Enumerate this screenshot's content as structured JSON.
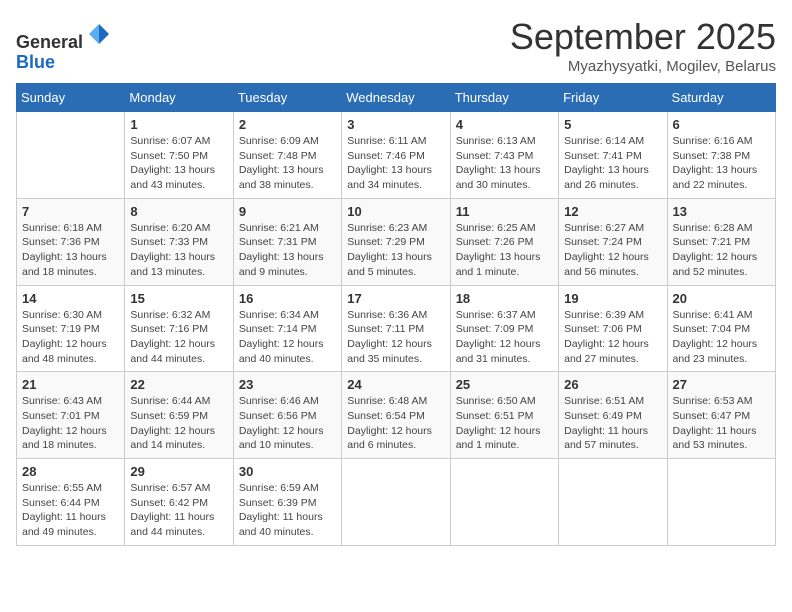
{
  "header": {
    "logo_line1": "General",
    "logo_line2": "Blue",
    "month_title": "September 2025",
    "location": "Myazhysyatki, Mogilev, Belarus"
  },
  "days_of_week": [
    "Sunday",
    "Monday",
    "Tuesday",
    "Wednesday",
    "Thursday",
    "Friday",
    "Saturday"
  ],
  "weeks": [
    [
      {
        "num": "",
        "info": ""
      },
      {
        "num": "1",
        "info": "Sunrise: 6:07 AM\nSunset: 7:50 PM\nDaylight: 13 hours\nand 43 minutes."
      },
      {
        "num": "2",
        "info": "Sunrise: 6:09 AM\nSunset: 7:48 PM\nDaylight: 13 hours\nand 38 minutes."
      },
      {
        "num": "3",
        "info": "Sunrise: 6:11 AM\nSunset: 7:46 PM\nDaylight: 13 hours\nand 34 minutes."
      },
      {
        "num": "4",
        "info": "Sunrise: 6:13 AM\nSunset: 7:43 PM\nDaylight: 13 hours\nand 30 minutes."
      },
      {
        "num": "5",
        "info": "Sunrise: 6:14 AM\nSunset: 7:41 PM\nDaylight: 13 hours\nand 26 minutes."
      },
      {
        "num": "6",
        "info": "Sunrise: 6:16 AM\nSunset: 7:38 PM\nDaylight: 13 hours\nand 22 minutes."
      }
    ],
    [
      {
        "num": "7",
        "info": "Sunrise: 6:18 AM\nSunset: 7:36 PM\nDaylight: 13 hours\nand 18 minutes."
      },
      {
        "num": "8",
        "info": "Sunrise: 6:20 AM\nSunset: 7:33 PM\nDaylight: 13 hours\nand 13 minutes."
      },
      {
        "num": "9",
        "info": "Sunrise: 6:21 AM\nSunset: 7:31 PM\nDaylight: 13 hours\nand 9 minutes."
      },
      {
        "num": "10",
        "info": "Sunrise: 6:23 AM\nSunset: 7:29 PM\nDaylight: 13 hours\nand 5 minutes."
      },
      {
        "num": "11",
        "info": "Sunrise: 6:25 AM\nSunset: 7:26 PM\nDaylight: 13 hours\nand 1 minute."
      },
      {
        "num": "12",
        "info": "Sunrise: 6:27 AM\nSunset: 7:24 PM\nDaylight: 12 hours\nand 56 minutes."
      },
      {
        "num": "13",
        "info": "Sunrise: 6:28 AM\nSunset: 7:21 PM\nDaylight: 12 hours\nand 52 minutes."
      }
    ],
    [
      {
        "num": "14",
        "info": "Sunrise: 6:30 AM\nSunset: 7:19 PM\nDaylight: 12 hours\nand 48 minutes."
      },
      {
        "num": "15",
        "info": "Sunrise: 6:32 AM\nSunset: 7:16 PM\nDaylight: 12 hours\nand 44 minutes."
      },
      {
        "num": "16",
        "info": "Sunrise: 6:34 AM\nSunset: 7:14 PM\nDaylight: 12 hours\nand 40 minutes."
      },
      {
        "num": "17",
        "info": "Sunrise: 6:36 AM\nSunset: 7:11 PM\nDaylight: 12 hours\nand 35 minutes."
      },
      {
        "num": "18",
        "info": "Sunrise: 6:37 AM\nSunset: 7:09 PM\nDaylight: 12 hours\nand 31 minutes."
      },
      {
        "num": "19",
        "info": "Sunrise: 6:39 AM\nSunset: 7:06 PM\nDaylight: 12 hours\nand 27 minutes."
      },
      {
        "num": "20",
        "info": "Sunrise: 6:41 AM\nSunset: 7:04 PM\nDaylight: 12 hours\nand 23 minutes."
      }
    ],
    [
      {
        "num": "21",
        "info": "Sunrise: 6:43 AM\nSunset: 7:01 PM\nDaylight: 12 hours\nand 18 minutes."
      },
      {
        "num": "22",
        "info": "Sunrise: 6:44 AM\nSunset: 6:59 PM\nDaylight: 12 hours\nand 14 minutes."
      },
      {
        "num": "23",
        "info": "Sunrise: 6:46 AM\nSunset: 6:56 PM\nDaylight: 12 hours\nand 10 minutes."
      },
      {
        "num": "24",
        "info": "Sunrise: 6:48 AM\nSunset: 6:54 PM\nDaylight: 12 hours\nand 6 minutes."
      },
      {
        "num": "25",
        "info": "Sunrise: 6:50 AM\nSunset: 6:51 PM\nDaylight: 12 hours\nand 1 minute."
      },
      {
        "num": "26",
        "info": "Sunrise: 6:51 AM\nSunset: 6:49 PM\nDaylight: 11 hours\nand 57 minutes."
      },
      {
        "num": "27",
        "info": "Sunrise: 6:53 AM\nSunset: 6:47 PM\nDaylight: 11 hours\nand 53 minutes."
      }
    ],
    [
      {
        "num": "28",
        "info": "Sunrise: 6:55 AM\nSunset: 6:44 PM\nDaylight: 11 hours\nand 49 minutes."
      },
      {
        "num": "29",
        "info": "Sunrise: 6:57 AM\nSunset: 6:42 PM\nDaylight: 11 hours\nand 44 minutes."
      },
      {
        "num": "30",
        "info": "Sunrise: 6:59 AM\nSunset: 6:39 PM\nDaylight: 11 hours\nand 40 minutes."
      },
      {
        "num": "",
        "info": ""
      },
      {
        "num": "",
        "info": ""
      },
      {
        "num": "",
        "info": ""
      },
      {
        "num": "",
        "info": ""
      }
    ]
  ]
}
